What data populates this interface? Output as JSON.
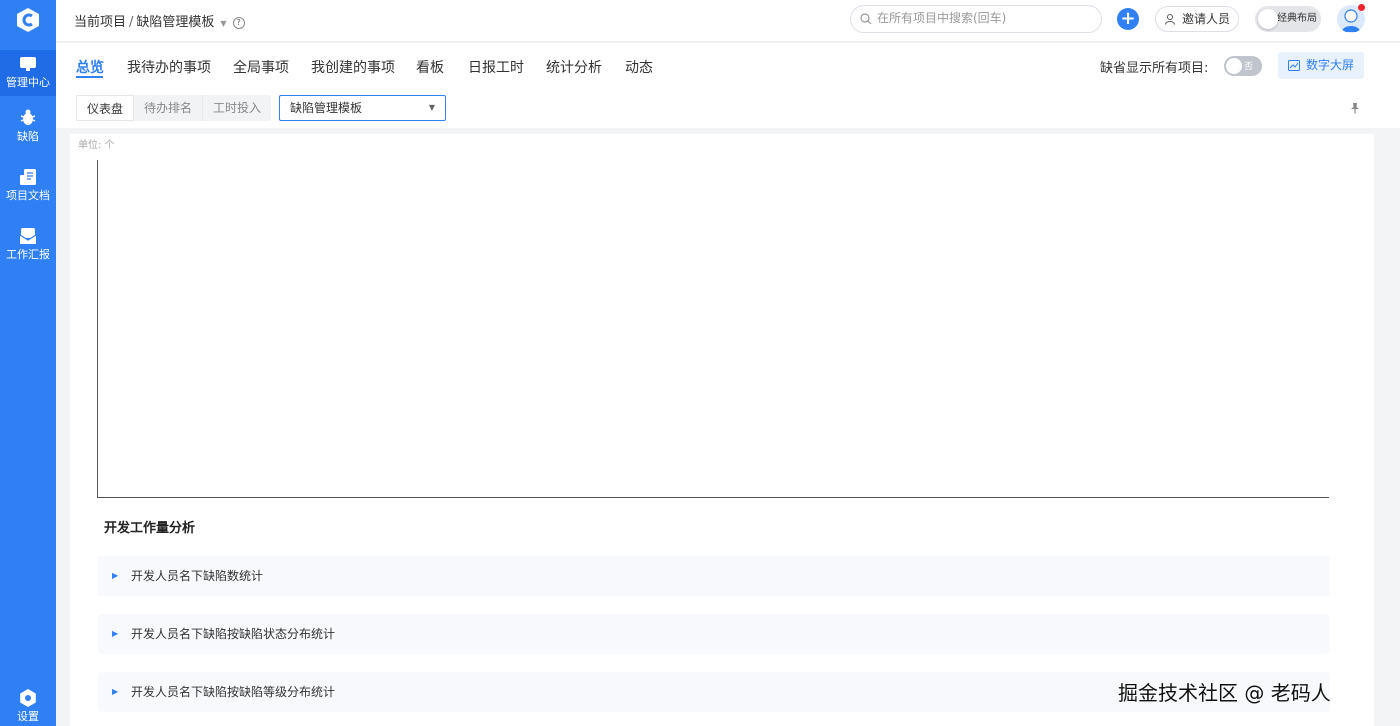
{
  "sidebar": {
    "items": [
      {
        "label": "管理中心",
        "icon": "monitor-icon"
      },
      {
        "label": "缺陷",
        "icon": "bug-icon"
      },
      {
        "label": "项目文档",
        "icon": "document-icon"
      },
      {
        "label": "工作汇报",
        "icon": "mail-icon"
      },
      {
        "label": "设置",
        "icon": "gear-icon"
      }
    ]
  },
  "header": {
    "breadcrumb_root": "当前项目",
    "breadcrumb_sep": "/",
    "breadcrumb_current": "缺陷管理模板",
    "help": "?",
    "search_placeholder": "在所有项目中搜索(回车)",
    "add": "+",
    "invite_label": "邀请人员",
    "layout_label": "经典布局"
  },
  "tabs": [
    {
      "label": "总览",
      "active": true
    },
    {
      "label": "我待办的事项"
    },
    {
      "label": "全局事项"
    },
    {
      "label": "我创建的事项"
    },
    {
      "label": "看板"
    },
    {
      "label": "日报工时"
    },
    {
      "label": "统计分析"
    },
    {
      "label": "动态"
    }
  ],
  "toolbar": {
    "show_all_label": "缺省显示所有项目:",
    "show_all_state": "否",
    "bigscreen_label": "数字大屏"
  },
  "subbar": {
    "segments": [
      "仪表盘",
      "待办排名",
      "工时投入"
    ],
    "template_select": "缺陷管理模板"
  },
  "chart": {
    "unit_label": "单位: 个"
  },
  "analysis": {
    "title": "开发工作量分析",
    "sections": [
      "开发人员名下缺陷数统计",
      "开发人员名下缺陷按缺陷状态分布统计",
      "开发人员名下缺陷按缺陷等级分布统计"
    ]
  },
  "watermark": "掘金技术社区 @ 老码人",
  "colors": {
    "accent": "#2f7ff5",
    "sidebar": "#2f7ff5"
  }
}
